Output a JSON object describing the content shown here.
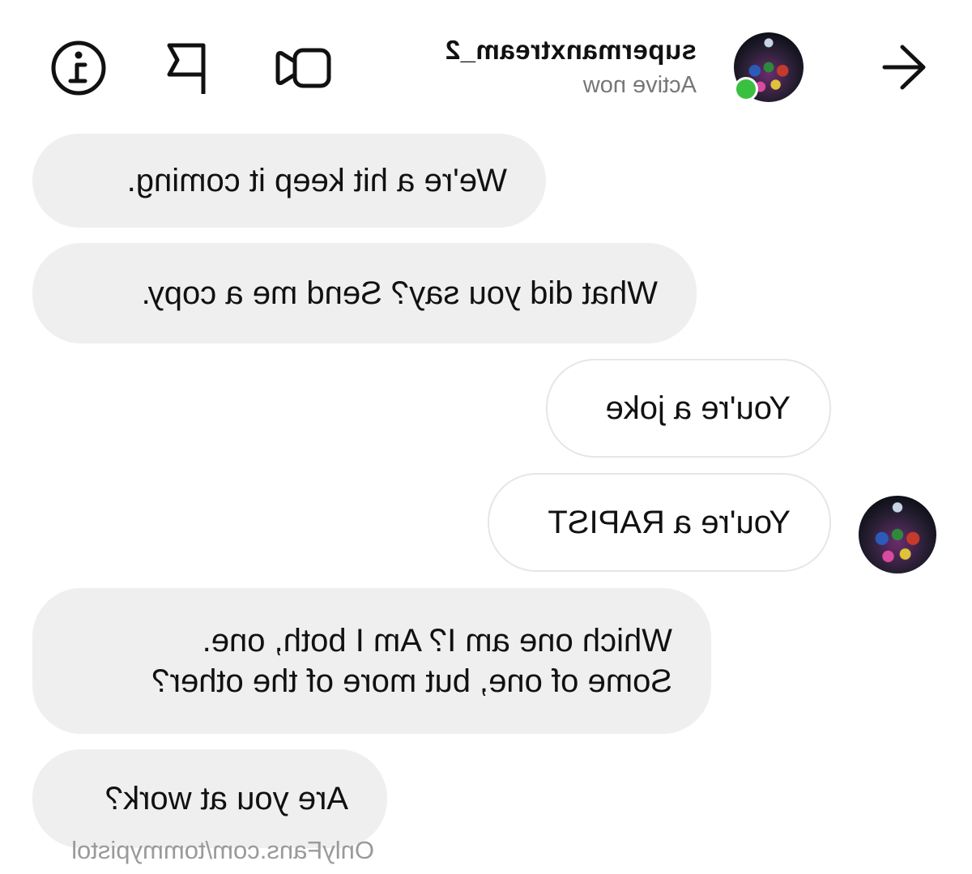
{
  "header": {
    "username": "supermanxtream_2",
    "status": "Active now",
    "icons": [
      "back-arrow-icon",
      "video-call-icon",
      "flag-icon",
      "info-icon"
    ]
  },
  "messages": [
    {
      "direction": "received",
      "lines": [
        "We're a hit keep it coming."
      ]
    },
    {
      "direction": "received",
      "lines": [
        "What did you say? Send me a copy."
      ]
    },
    {
      "direction": "sent",
      "lines": [
        "You're a joke"
      ]
    },
    {
      "direction": "sent",
      "lines": [
        "You're a RAPIST"
      ]
    },
    {
      "direction": "received",
      "lines": [
        "Which one am I? Am I both, one.",
        "Some of one, but more of the other?"
      ]
    },
    {
      "direction": "received",
      "lines": [
        "Are you at work?"
      ]
    }
  ],
  "watermark": "OnlyFans.com/tommypistol",
  "colors": {
    "received_bubble": "#efefef",
    "sent_bubble_border": "#e6e6e6",
    "online": "#3ac040",
    "muted_text": "#777777"
  }
}
